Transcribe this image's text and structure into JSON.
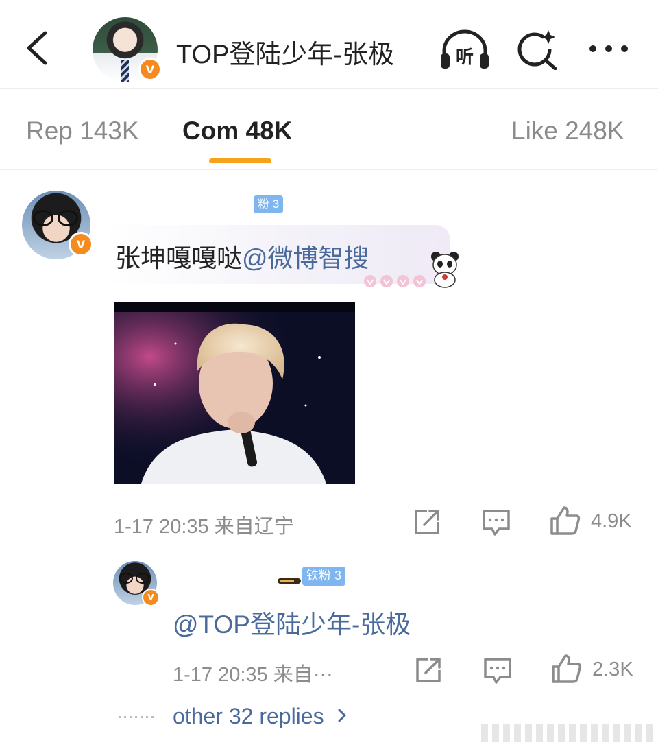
{
  "header": {
    "title": "TOP登陆少年-张极",
    "verified_badge": "V",
    "listen_label": "听"
  },
  "tabs": [
    {
      "label": "Rep 143K"
    },
    {
      "label": "Com 48K"
    },
    {
      "label": "Like 248K"
    }
  ],
  "comment": {
    "fan_badge": "粉 3",
    "text": "张坤嘎嘎哒",
    "mention": "@微博智搜",
    "meta": "1-17 20:35  来自辽宁",
    "likes": "4.9K"
  },
  "reply": {
    "fan_badge": "铁粉 3",
    "text": "@TOP登陆少年-张极",
    "meta": "1-17 20:35  来自⋯",
    "likes": "2.3K"
  },
  "more_replies": {
    "label": "other 32 replies"
  },
  "colors": {
    "accent": "#f7a21b",
    "link": "#4a6a9c",
    "verified": "#f58a1f",
    "fan_badge": "#7fb6ef"
  },
  "icons": {
    "back": "chevron-left-icon",
    "listen": "headphones-icon",
    "search": "ai-search-icon",
    "more": "more-dots-icon",
    "share": "share-icon",
    "comment": "comment-icon",
    "like": "thumbs-up-icon"
  }
}
